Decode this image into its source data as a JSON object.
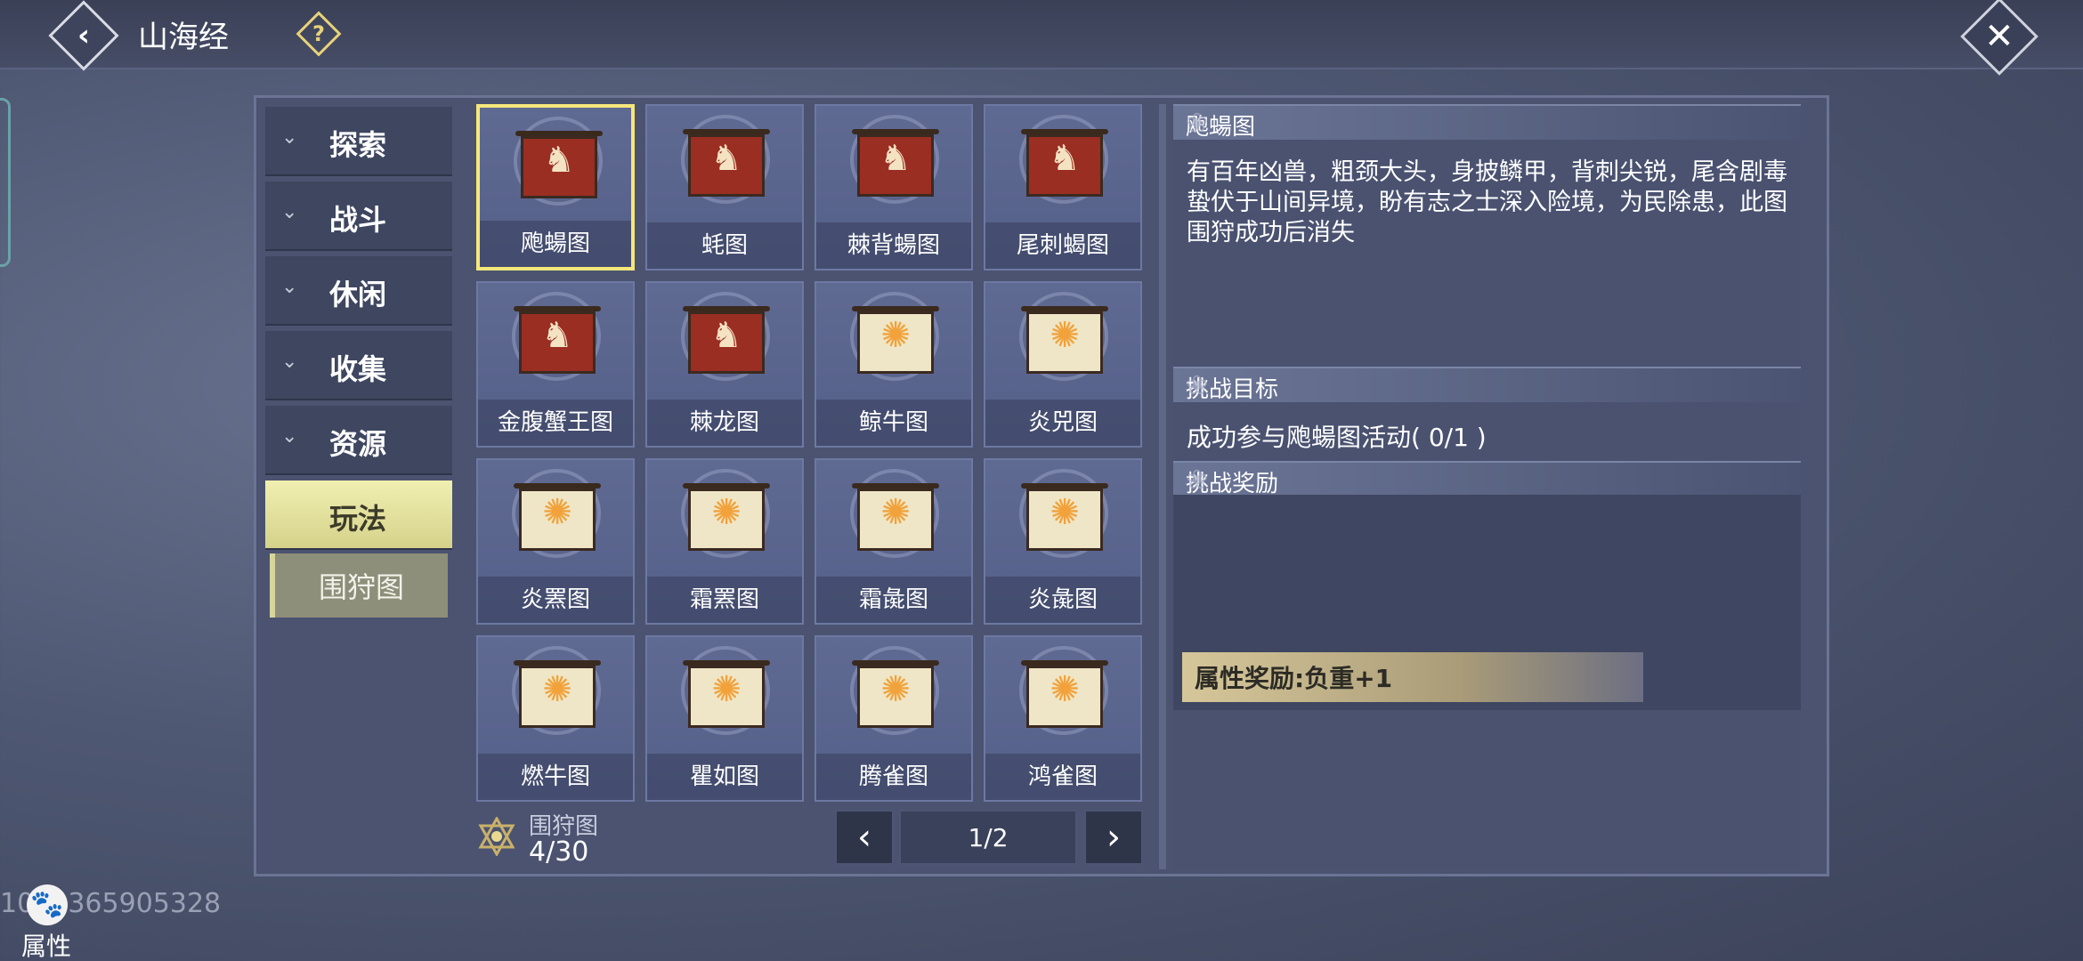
{
  "header": {
    "title": "山海经",
    "back_icon": "‹",
    "help_icon": "?",
    "close_icon": "✕"
  },
  "categories": [
    {
      "label": "探索",
      "state": "collapsed"
    },
    {
      "label": "战斗",
      "state": "collapsed"
    },
    {
      "label": "休闲",
      "state": "collapsed"
    },
    {
      "label": "收集",
      "state": "collapsed"
    },
    {
      "label": "资源",
      "state": "collapsed"
    },
    {
      "label": "玩法",
      "state": "active"
    }
  ],
  "sub_category": {
    "label": "围狩图"
  },
  "grid": {
    "items": [
      {
        "name": "飑蝪图",
        "art": "red"
      },
      {
        "name": "蚝图",
        "art": "red"
      },
      {
        "name": "棘背蝪图",
        "art": "red"
      },
      {
        "name": "尾刺蝎图",
        "art": "red"
      },
      {
        "name": "金腹蟹王图",
        "art": "red"
      },
      {
        "name": "棘龙图",
        "art": "red"
      },
      {
        "name": "鲸牛图",
        "art": "yellow"
      },
      {
        "name": "炎兕图",
        "art": "yellow"
      },
      {
        "name": "炎罴图",
        "art": "yellow"
      },
      {
        "name": "霜罴图",
        "art": "yellow"
      },
      {
        "name": "霜彘图",
        "art": "yellow"
      },
      {
        "name": "炎彘图",
        "art": "yellow"
      },
      {
        "name": "燃牛图",
        "art": "yellow"
      },
      {
        "name": "瞿如图",
        "art": "yellow"
      },
      {
        "name": "腾雀图",
        "art": "yellow"
      },
      {
        "name": "鸿雀图",
        "art": "yellow"
      }
    ],
    "selected_index": 0
  },
  "footer": {
    "collection_label": "围狩图",
    "collection_count": "4/30",
    "page": "1/2",
    "prev_icon": "‹",
    "next_icon": "›"
  },
  "detail": {
    "title": "飑蝪图",
    "description_1": "有百年凶兽，粗颈大头，身披鳞甲，背刺尖锐，尾含剧毒",
    "description_2": "蛰伏于山间异境，盼有志之士深入险境，为民除患，此图围狩成功后消失",
    "goal_header": "挑战目标",
    "goal_text": "成功参与飑蝪图活动( 0/1 )",
    "reward_header": "挑战奖励",
    "reward_text": "属性奖励:负重+1"
  },
  "uid_text": "1052365905328",
  "attr_button": {
    "label": "属性",
    "icon": "paw-icon"
  },
  "colors": {
    "accent": "#f6e77a",
    "panel": "#4b5370",
    "active_tab": "#e4e2a0"
  }
}
